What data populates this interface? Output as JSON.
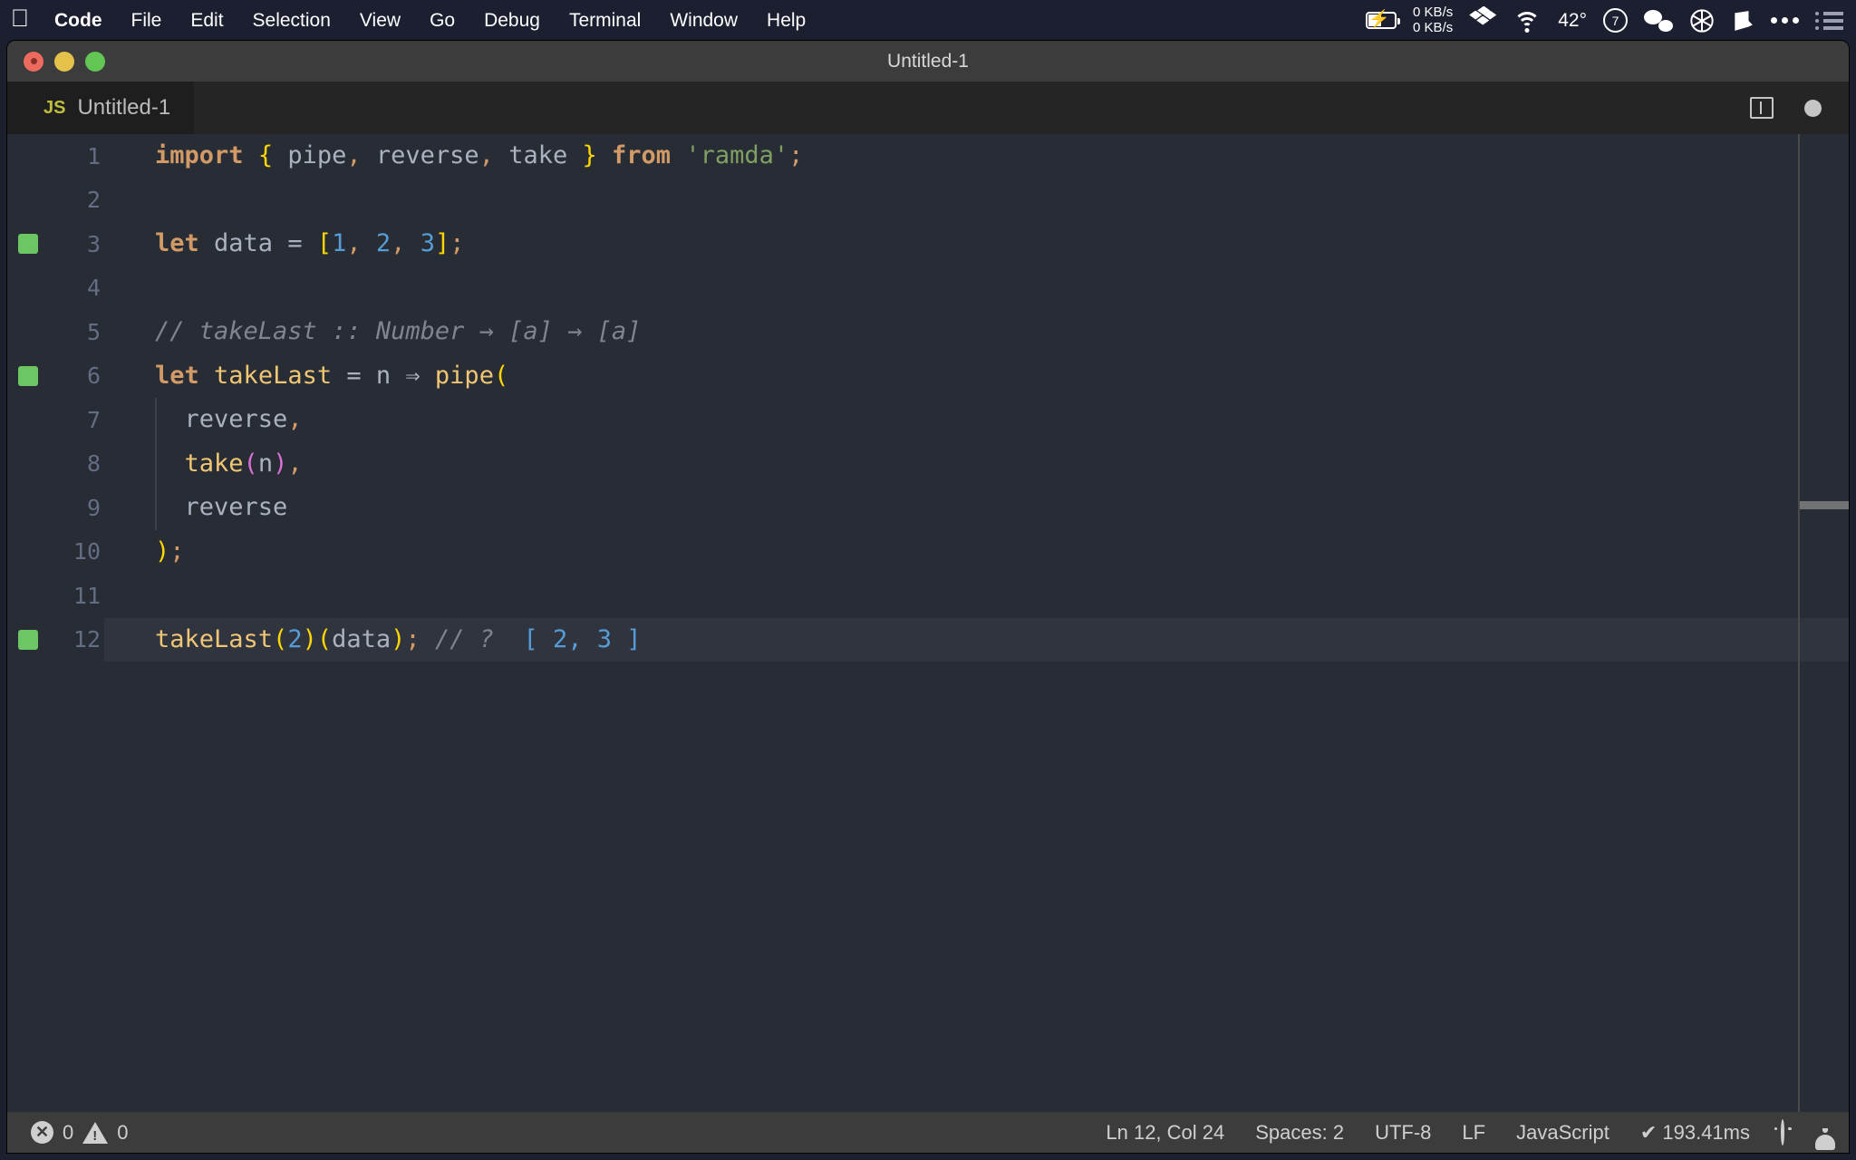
{
  "menubar": {
    "apple_icon": "apple-logo-icon",
    "items": [
      {
        "label": "Code",
        "bold": true
      },
      {
        "label": "File",
        "bold": false
      },
      {
        "label": "Edit",
        "bold": false
      },
      {
        "label": "Selection",
        "bold": false
      },
      {
        "label": "View",
        "bold": false
      },
      {
        "label": "Go",
        "bold": false
      },
      {
        "label": "Debug",
        "bold": false
      },
      {
        "label": "Terminal",
        "bold": false
      },
      {
        "label": "Window",
        "bold": false
      },
      {
        "label": "Help",
        "bold": false
      }
    ],
    "status": {
      "battery_icon": "battery-charging-icon",
      "net_up": "0 KB/s",
      "net_down": "0 KB/s",
      "dropbox_icon": "dropbox-icon",
      "wifi_icon": "wifi-icon",
      "temperature": "42°",
      "clock_badge": "7",
      "wechat_icon": "wechat-icon",
      "aperture_icon": "aperture-icon",
      "cube_icon": "cube-icon",
      "overflow_icon": "ellipsis-icon",
      "controlcenter_icon": "list-icon"
    }
  },
  "window": {
    "title": "Untitled-1",
    "traffic_lights": [
      "close",
      "minimize",
      "zoom"
    ]
  },
  "tabs": [
    {
      "badge": "JS",
      "label": "Untitled-1",
      "dirty": true
    }
  ],
  "editor_actions": {
    "split_editor": "split-editor-icon",
    "unsaved_indicator": "dirty-dot-icon"
  },
  "editor": {
    "lines": [
      {
        "no": "1",
        "changed": false,
        "active": false,
        "indent_guide": false,
        "tokens": [
          {
            "t": "import",
            "c": "t-kw"
          },
          {
            "t": " ",
            "c": "t-var"
          },
          {
            "t": "{",
            "c": "t-brace"
          },
          {
            "t": " pipe",
            "c": "t-var"
          },
          {
            "t": ",",
            "c": "t-punc"
          },
          {
            "t": " reverse",
            "c": "t-var"
          },
          {
            "t": ",",
            "c": "t-punc"
          },
          {
            "t": " take ",
            "c": "t-var"
          },
          {
            "t": "}",
            "c": "t-brace"
          },
          {
            "t": " ",
            "c": "t-var"
          },
          {
            "t": "from",
            "c": "t-kw"
          },
          {
            "t": " ",
            "c": "t-var"
          },
          {
            "t": "'ramda'",
            "c": "t-str"
          },
          {
            "t": ";",
            "c": "t-punc"
          }
        ]
      },
      {
        "no": "2",
        "changed": false,
        "active": false,
        "indent_guide": false,
        "tokens": []
      },
      {
        "no": "3",
        "changed": true,
        "active": false,
        "indent_guide": false,
        "tokens": [
          {
            "t": "let",
            "c": "t-kw"
          },
          {
            "t": " data ",
            "c": "t-var"
          },
          {
            "t": "= ",
            "c": "t-var"
          },
          {
            "t": "[",
            "c": "t-brace"
          },
          {
            "t": "1",
            "c": "t-num"
          },
          {
            "t": ",",
            "c": "t-punc"
          },
          {
            "t": " ",
            "c": "t-var"
          },
          {
            "t": "2",
            "c": "t-num"
          },
          {
            "t": ",",
            "c": "t-punc"
          },
          {
            "t": " ",
            "c": "t-var"
          },
          {
            "t": "3",
            "c": "t-num"
          },
          {
            "t": "]",
            "c": "t-brace"
          },
          {
            "t": ";",
            "c": "t-punc"
          }
        ]
      },
      {
        "no": "4",
        "changed": false,
        "active": false,
        "indent_guide": false,
        "tokens": []
      },
      {
        "no": "5",
        "changed": false,
        "active": false,
        "indent_guide": false,
        "tokens": [
          {
            "t": "// takeLast :: Number → [a] → [a]",
            "c": "t-comment"
          }
        ]
      },
      {
        "no": "6",
        "changed": true,
        "active": false,
        "indent_guide": false,
        "tokens": [
          {
            "t": "let",
            "c": "t-kw"
          },
          {
            "t": " ",
            "c": "t-var"
          },
          {
            "t": "takeLast",
            "c": "t-fn"
          },
          {
            "t": " = ",
            "c": "t-var"
          },
          {
            "t": "n",
            "c": "t-var"
          },
          {
            "t": " ⇒ ",
            "c": "t-var"
          },
          {
            "t": "pipe",
            "c": "t-fn"
          },
          {
            "t": "(",
            "c": "t-paren2"
          }
        ]
      },
      {
        "no": "7",
        "changed": false,
        "active": false,
        "indent_guide": true,
        "tokens": [
          {
            "t": "  reverse",
            "c": "t-var"
          },
          {
            "t": ",",
            "c": "t-punc"
          }
        ]
      },
      {
        "no": "8",
        "changed": false,
        "active": false,
        "indent_guide": true,
        "tokens": [
          {
            "t": "  ",
            "c": "t-var"
          },
          {
            "t": "take",
            "c": "t-fn"
          },
          {
            "t": "(",
            "c": "t-paren"
          },
          {
            "t": "n",
            "c": "t-var"
          },
          {
            "t": ")",
            "c": "t-paren"
          },
          {
            "t": ",",
            "c": "t-punc"
          }
        ]
      },
      {
        "no": "9",
        "changed": false,
        "active": false,
        "indent_guide": true,
        "tokens": [
          {
            "t": "  reverse",
            "c": "t-var"
          }
        ]
      },
      {
        "no": "10",
        "changed": false,
        "active": false,
        "indent_guide": false,
        "tokens": [
          {
            "t": ")",
            "c": "t-paren2"
          },
          {
            "t": ";",
            "c": "t-punc"
          }
        ]
      },
      {
        "no": "11",
        "changed": false,
        "active": false,
        "indent_guide": false,
        "tokens": []
      },
      {
        "no": "12",
        "changed": true,
        "active": true,
        "indent_guide": false,
        "tokens": [
          {
            "t": "takeLast",
            "c": "t-fn"
          },
          {
            "t": "(",
            "c": "t-paren2"
          },
          {
            "t": "2",
            "c": "t-num"
          },
          {
            "t": ")",
            "c": "t-paren2"
          },
          {
            "t": "(",
            "c": "t-paren2"
          },
          {
            "t": "data",
            "c": "t-var"
          },
          {
            "t": ")",
            "c": "t-paren2"
          },
          {
            "t": ";",
            "c": "t-punc"
          },
          {
            "t": " ",
            "c": "t-var"
          },
          {
            "t": "// ?",
            "c": "t-comment"
          },
          {
            "t": "  ",
            "c": "t-var"
          },
          {
            "t": "[ 2, 3 ]",
            "c": "t-result"
          }
        ]
      }
    ]
  },
  "statusbar": {
    "errors_icon": "error-icon",
    "errors": "0",
    "warnings_icon": "warning-icon",
    "warnings": "0",
    "cursor_position": "Ln 12, Col 24",
    "indentation": "Spaces: 2",
    "encoding": "UTF-8",
    "eol": "LF",
    "language": "JavaScript",
    "run_time": "✔ 193.41ms",
    "feedback_icon": "smiley-icon",
    "notifications_icon": "bell-icon"
  }
}
